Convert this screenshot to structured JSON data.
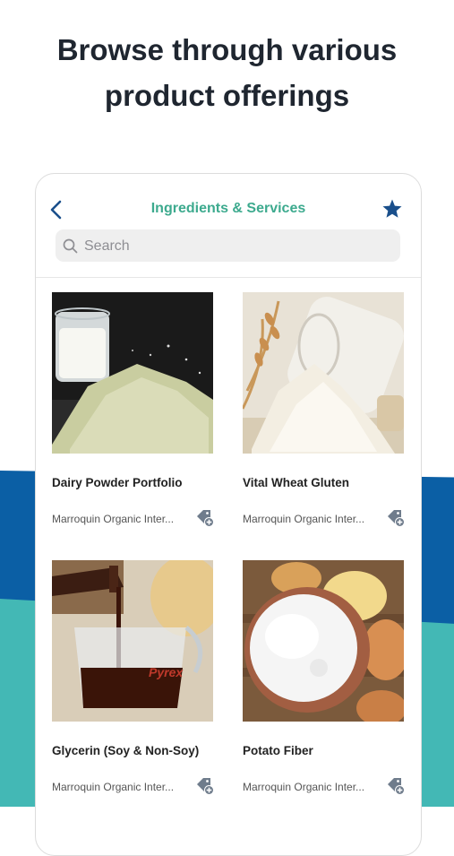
{
  "headline": {
    "line1": "Browse through various",
    "line2": "product offerings"
  },
  "nav": {
    "title": "Ingredients & Services",
    "back_icon": "chevron-left-icon",
    "favorite_icon": "star-icon"
  },
  "search": {
    "placeholder": "Search"
  },
  "products": [
    {
      "name": "Dairy Powder Portfolio",
      "vendor": "Marroquin Organic Inter..."
    },
    {
      "name": "Vital Wheat Gluten",
      "vendor": "Marroquin Organic Inter..."
    },
    {
      "name": "Glycerin (Soy & Non-Soy)",
      "vendor": "Marroquin Organic Inter..."
    },
    {
      "name": "Potato Fiber",
      "vendor": "Marroquin Organic Inter..."
    }
  ],
  "colors": {
    "accent_green": "#3daa8e",
    "nav_blue": "#1a4f8b",
    "band_blue": "#0b5fa5",
    "band_teal": "#43b8b5"
  }
}
